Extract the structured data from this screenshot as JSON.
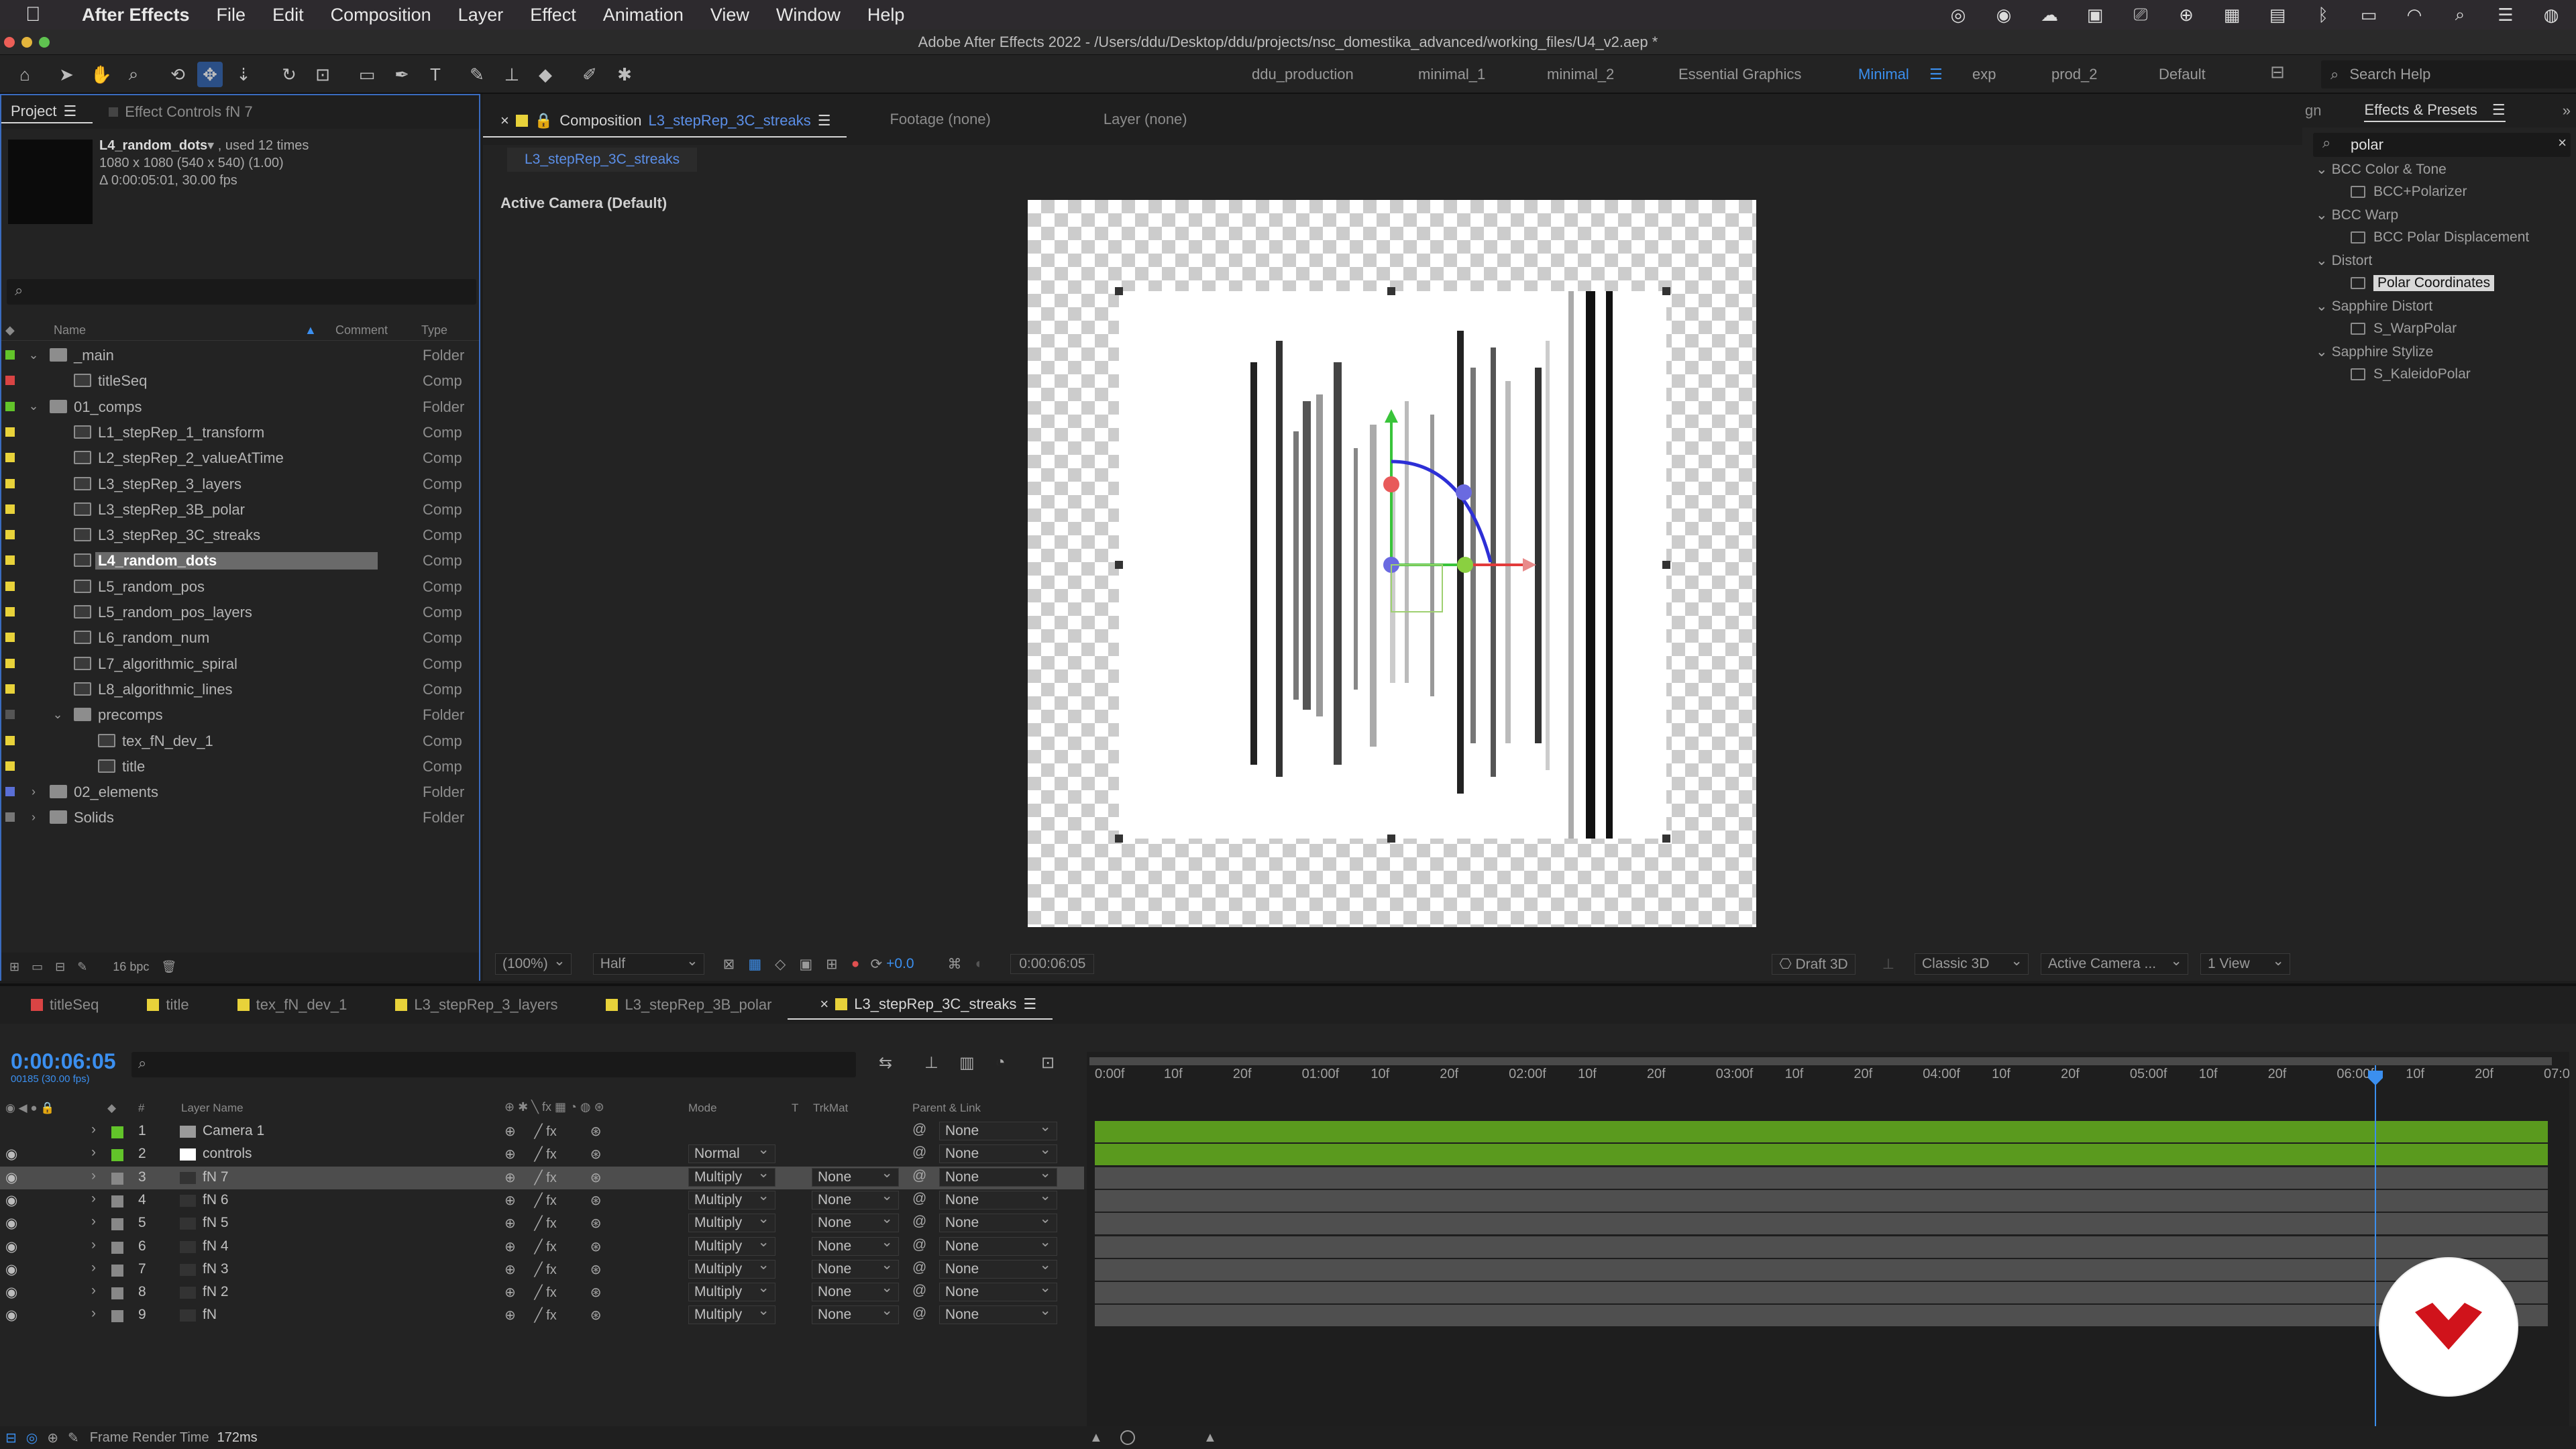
{
  "menubar": {
    "app_name": "After Effects",
    "items": [
      "File",
      "Edit",
      "Composition",
      "Layer",
      "Effect",
      "Animation",
      "View",
      "Window",
      "Help"
    ]
  },
  "window": {
    "title": "Adobe After Effects 2022 - /Users/ddu/Desktop/ddu/projects/nsc_domestika_advanced/working_files/U4_v2.aep *"
  },
  "workspaces": {
    "items": [
      "ddu_production",
      "minimal_1",
      "minimal_2",
      "Essential Graphics",
      "Minimal",
      "exp",
      "prod_2",
      "Default"
    ],
    "active": "Minimal",
    "search_placeholder": "Search Help"
  },
  "project_panel": {
    "tab_project": "Project",
    "tab_effect_controls": "Effect Controls fN 7",
    "selected_name": "L4_random_dots",
    "used": ", used 12 times",
    "dims": "1080 x 1080  (540 x 540) (1.00)",
    "duration": "Δ 0:00:05:01, 30.00 fps",
    "col_name": "Name",
    "col_comment": "Comment",
    "col_type": "Type",
    "items": [
      {
        "name": "_main",
        "type": "Folder"
      },
      {
        "name": "titleSeq",
        "type": "Comp"
      },
      {
        "name": "01_comps",
        "type": "Folder"
      },
      {
        "name": "L1_stepRep_1_transform",
        "type": "Comp"
      },
      {
        "name": "L2_stepRep_2_valueAtTime",
        "type": "Comp"
      },
      {
        "name": "L3_stepRep_3_layers",
        "type": "Comp"
      },
      {
        "name": "L3_stepRep_3B_polar",
        "type": "Comp"
      },
      {
        "name": "L3_stepRep_3C_streaks",
        "type": "Comp"
      },
      {
        "name": "L4_random_dots",
        "type": "Comp"
      },
      {
        "name": "L5_random_pos",
        "type": "Comp"
      },
      {
        "name": "L5_random_pos_layers",
        "type": "Comp"
      },
      {
        "name": "L6_random_num",
        "type": "Comp"
      },
      {
        "name": "L7_algorithmic_spiral",
        "type": "Comp"
      },
      {
        "name": "L8_algorithmic_lines",
        "type": "Comp"
      },
      {
        "name": "precomps",
        "type": "Folder"
      },
      {
        "name": "tex_fN_dev_1",
        "type": "Comp"
      },
      {
        "name": "title",
        "type": "Comp"
      },
      {
        "name": "02_elements",
        "type": "Folder"
      },
      {
        "name": "Solids",
        "type": "Folder"
      }
    ],
    "bpc": "16 bpc"
  },
  "comp_panel": {
    "tab_prefix": "Composition",
    "comp_name": "L3_stepRep_3C_streaks",
    "tab_footage": "Footage (none)",
    "tab_layer": "Layer (none)",
    "active_camera": "Active Camera (Default)",
    "zoom": "(100%)",
    "resolution": "Half",
    "exposure": "+0.0",
    "timecode": "0:00:06:05",
    "renderer": "Draft 3D",
    "renderer_mode": "Classic 3D",
    "camera": "Active Camera ...",
    "views": "1 View"
  },
  "effects_panel": {
    "tab_partial": "gn",
    "title": "Effects & Presets",
    "search_value": "polar",
    "categories": [
      {
        "name": "BCC Color & Tone",
        "items": [
          "BCC+Polarizer"
        ]
      },
      {
        "name": "BCC Warp",
        "items": [
          "BCC Polar Displacement"
        ]
      },
      {
        "name": "Distort",
        "items": [
          "Polar Coordinates"
        ]
      },
      {
        "name": "Sapphire Distort",
        "items": [
          "S_WarpPolar"
        ]
      },
      {
        "name": "Sapphire Stylize",
        "items": [
          "S_KaleidoPolar"
        ]
      }
    ],
    "selected": "Polar Coordinates"
  },
  "timeline": {
    "tabs": [
      "titleSeq",
      "title",
      "tex_fN_dev_1",
      "L3_stepRep_3_layers",
      "L3_stepRep_3B_polar",
      "L3_stepRep_3C_streaks"
    ],
    "active_tab": "L3_stepRep_3C_streaks",
    "timecode": "0:00:06:05",
    "fps": "00185 (30.00 fps)",
    "col_layer_name": "Layer Name",
    "col_mode": "Mode",
    "col_t": "T",
    "col_trkmat": "TrkMat",
    "col_parent": "Parent & Link",
    "layers": [
      {
        "num": "1",
        "name": "Camera 1",
        "mode": "",
        "trkmat": "",
        "parent": "None",
        "color": "#62c42a"
      },
      {
        "num": "2",
        "name": "controls",
        "mode": "Normal",
        "trkmat": "",
        "parent": "None",
        "color": "#62c42a"
      },
      {
        "num": "3",
        "name": "fN 7",
        "mode": "Multiply",
        "trkmat": "None",
        "parent": "None",
        "color": "#888888"
      },
      {
        "num": "4",
        "name": "fN 6",
        "mode": "Multiply",
        "trkmat": "None",
        "parent": "None",
        "color": "#888888"
      },
      {
        "num": "5",
        "name": "fN 5",
        "mode": "Multiply",
        "trkmat": "None",
        "parent": "None",
        "color": "#888888"
      },
      {
        "num": "6",
        "name": "fN 4",
        "mode": "Multiply",
        "trkmat": "None",
        "parent": "None",
        "color": "#888888"
      },
      {
        "num": "7",
        "name": "fN 3",
        "mode": "Multiply",
        "trkmat": "None",
        "parent": "None",
        "color": "#888888"
      },
      {
        "num": "8",
        "name": "fN 2",
        "mode": "Multiply",
        "trkmat": "None",
        "parent": "None",
        "color": "#888888"
      },
      {
        "num": "9",
        "name": "fN",
        "mode": "Multiply",
        "trkmat": "None",
        "parent": "None",
        "color": "#888888"
      }
    ],
    "ruler": [
      "0:00f",
      "10f",
      "20f",
      "01:00f",
      "10f",
      "20f",
      "02:00f",
      "10f",
      "20f",
      "03:00f",
      "10f",
      "20f",
      "04:00f",
      "10f",
      "20f",
      "05:00f",
      "10f",
      "20f",
      "06:00f",
      "10f",
      "20f",
      "07:0"
    ],
    "status_label": "Frame Render Time",
    "status_value": "172ms"
  },
  "colors": {
    "accent_blue": "#3b8fef",
    "label_green": "#62c42a",
    "label_yellow": "#e8d23a",
    "label_red": "#d94444",
    "label_blue": "#5a6fd6",
    "track_green": "#5a9a1e"
  }
}
